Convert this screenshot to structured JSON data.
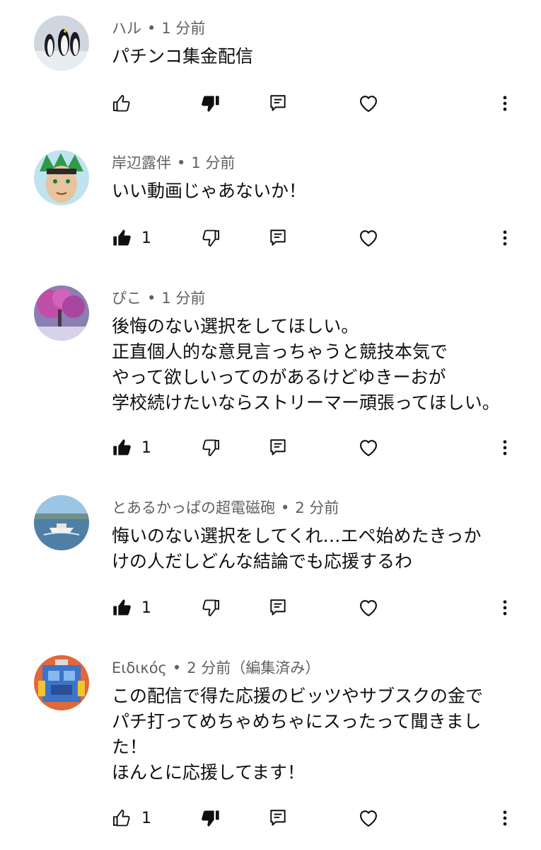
{
  "comments": [
    {
      "author": "ハル",
      "time": "1 分前",
      "edited": "",
      "text": "パチンコ集金配信",
      "likes": "",
      "liked": false,
      "disliked": true,
      "avatar_icon": "penguins-avatar"
    },
    {
      "author": "岸辺露伴",
      "time": "1 分前",
      "edited": "",
      "text": "いい動画じゃあないか！",
      "likes": "1",
      "liked": true,
      "disliked": false,
      "avatar_icon": "anime-character-avatar"
    },
    {
      "author": "ぴこ",
      "time": "1 分前",
      "edited": "",
      "text": "後悔のない選択をしてほしい。\n正直個人的な意見言っちゃうと競技本気で\nやって欲しいってのがあるけどゆきーおが\n学校続けたいならストリーマー頑張ってほしい。",
      "likes": "1",
      "liked": true,
      "disliked": false,
      "avatar_icon": "purple-tree-avatar"
    },
    {
      "author": "とあるかっぱの超電磁砲",
      "time": "2 分前",
      "edited": "",
      "text": "悔いのない選択をしてくれ…エペ始めたきっか\nけの人だしどんな結論でも応援するわ",
      "likes": "1",
      "liked": true,
      "disliked": false,
      "avatar_icon": "boat-sea-avatar"
    },
    {
      "author": "Ειδικός",
      "time": "2 分前",
      "edited": "（編集済み）",
      "text": "この配信で得た応援のビッツやサブスクの金で\nパチ打ってめちゃめちゃにスったって聞きまし\nた！\nほんとに応援してます！",
      "likes": "1",
      "liked": false,
      "disliked": true,
      "avatar_icon": "robot-avatar"
    }
  ],
  "dot": "•",
  "icons": {
    "like": "thumbs-up-icon",
    "dislike": "thumbs-down-icon",
    "reply": "reply-icon",
    "heart": "heart-icon",
    "more": "more-vertical-icon"
  }
}
